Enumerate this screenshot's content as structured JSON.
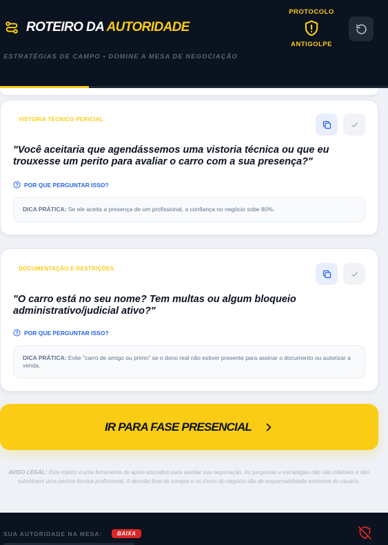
{
  "header": {
    "title_part1": "ROTEIRO DA",
    "title_part2": "AUTORIDADE",
    "subtitle": "ESTRATÉGIAS DE CAMPO • DOMINE A MESA DE NEGOCIAÇÃO",
    "protocol_top": "PROTOCOLO",
    "protocol_bottom": "ANTIGOLPE",
    "progress": 0.23
  },
  "cards": [
    {
      "category": "VISTORIA TÉCNICO-PERICIAL",
      "question": "\"Você aceitaria que agendássemos uma vistoria técnica ou que eu trouxesse um perito para avaliar o carro com a sua presença?\"",
      "why_label": "POR QUE PERGUNTAR ISSO?",
      "tip_label": "DICA PRÁTICA:",
      "tip_text": "Se ele aceita a presença de um profissional, a confiança no negócio sobe 80%."
    },
    {
      "category": "DOCUMENTAÇÃO E RESTRIÇÕES",
      "question": "\"O carro está no seu nome? Tem multas ou algum bloqueio administrativo/judicial ativo?\"",
      "why_label": "POR QUE PERGUNTAR ISSO?",
      "tip_label": "DICA PRÁTICA:",
      "tip_text": "Evite \"carro de amigo ou primo\" se o dono real não estiver presente para assinar o documento ou autorizar a venda."
    }
  ],
  "cta": {
    "label": "IR PARA FASE PRESENCIAL"
  },
  "disclaimer": {
    "label": "AVISO LEGAL:",
    "text": "Este roteiro é uma ferramenta de apoio educativo para auxiliar sua negociação. As perguntas e estratégias não são infalíveis e não substituem uma perícia técnica profissional. A decisão final de compra e os riscos do negócio são de responsabilidade exclusiva do usuário."
  },
  "footer": {
    "label": "SUA AUTORIDADE NA MESA:",
    "level": "BAIXA"
  },
  "colors": {
    "accent": "#facc15",
    "dark": "#0b1220",
    "link": "#2563eb",
    "danger": "#dc2626"
  },
  "icons": [
    "route-icon",
    "shield-alert-icon",
    "reset-icon",
    "copy-icon",
    "check-icon",
    "help-circle-icon",
    "chevron-right-icon",
    "shield-off-icon"
  ]
}
